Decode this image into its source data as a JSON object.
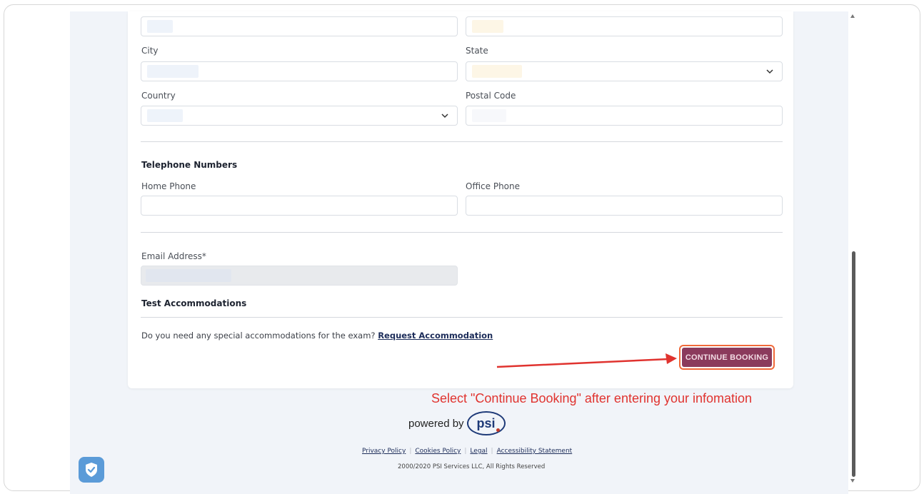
{
  "form": {
    "city_label": "City",
    "state_label": "State",
    "country_label": "Country",
    "postal_code_label": "Postal Code",
    "telephone_heading": "Telephone Numbers",
    "home_phone_label": "Home Phone",
    "office_phone_label": "Office Phone",
    "email_label": "Email Address*",
    "accommodations_heading": "Test Accommodations",
    "accommodations_question": "Do you need any special accommodations for the exam?",
    "request_accommodation_link": "Request Accommodation",
    "continue_button": "CONTINUE BOOKING"
  },
  "annotation": {
    "text": "Select \"Continue Booking\" after entering your infomation",
    "color": "#e0332f"
  },
  "footer": {
    "powered_by": "powered by",
    "logo_text": "psi",
    "links": [
      "Privacy Policy",
      "Cookies Policy",
      "Legal",
      "Accessibility Statement"
    ],
    "copyright": "2000/2020 PSI Services LLC, All Rights Reserved"
  },
  "colors": {
    "button_bg": "#8b3a5c",
    "button_highlight": "#f0693a",
    "link": "#1d2d5a",
    "page_bg": "#f1f4f9"
  },
  "icons": {
    "state_select": "chevron-down-icon",
    "country_select": "chevron-down-icon",
    "privacy_widget": "shield-check-icon"
  }
}
